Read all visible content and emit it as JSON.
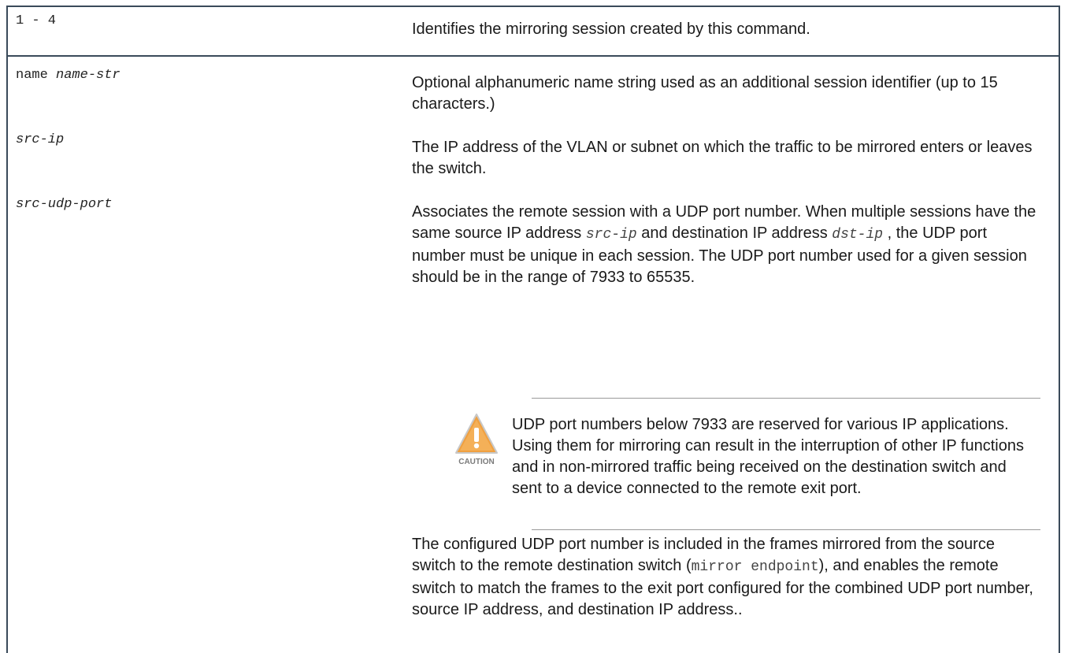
{
  "rows": [
    {
      "param": "1 - 4",
      "desc": "Identifies the mirroring session created by this command."
    },
    {
      "param_kw": "name",
      "param_arg": "name-str",
      "desc": "Optional alphanumeric name string used as an additional session identifier (up to 15 characters.)"
    },
    {
      "param_arg": "src-ip",
      "desc": "The IP address of the VLAN or subnet on which the traffic to be mirrored enters or leaves the switch."
    },
    {
      "param_arg": "src-udp-port",
      "desc_part1": "Associates the remote session with a UDP port number. When multiple sessions have the same source IP address",
      "desc_code1": "src-ip",
      "desc_part2": "and destination IP address",
      "desc_code2": "dst-ip",
      "desc_part3": ", the UDP port number must be unique in each session. The UDP port number used for a given session should be in the range of 7933 to 65535.",
      "caution": {
        "icon": "caution-icon",
        "label": "CAUTION",
        "text": "UDP port numbers below 7933 are reserved for various IP applications. Using them for mirroring can result in the interruption of other IP functions and in non-mirrored traffic being received on the destination switch and sent to a device connected to the remote exit port."
      },
      "after_part1": "The configured UDP port number is included in the frames mirrored from the source switch to the remote destination switch (",
      "after_code": "mirror endpoint",
      "after_part2": "), and enables the remote switch to match the frames to the exit port configured for the combined UDP port number, source IP address, and destination IP address.."
    }
  ],
  "colors": {
    "frame": "#3a4a5a",
    "caution_orange": "#f0a040",
    "caution_dark": "#d98a2b"
  }
}
